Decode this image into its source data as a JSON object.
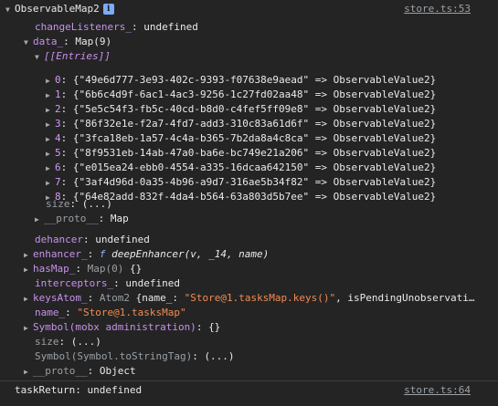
{
  "top_source": "store.ts:53",
  "bottom_source": "store.ts:64",
  "root": {
    "name": "ObservableMap2",
    "info_glyph": "i"
  },
  "change_listeners": {
    "key": "changeListeners_",
    "value": "undefined"
  },
  "data": {
    "key": "data_",
    "value": "Map(9)"
  },
  "entries_label": "[[Entries]]",
  "entries": [
    {
      "index": "0",
      "text": "{\"49e6d777-3e93-402c-9393-f07638e9aead\" => ObservableValue2}"
    },
    {
      "index": "1",
      "text": "{\"6b6c4d9f-6ac1-4ac3-9256-1c27fd02aa48\" => ObservableValue2}"
    },
    {
      "index": "2",
      "text": "{\"5e5c54f3-fb5c-40cd-b8d0-c4fef5ff09e8\" => ObservableValue2}"
    },
    {
      "index": "3",
      "text": "{\"86f32e1e-f2a7-4fd7-add3-310c83a61d6f\" => ObservableValue2}"
    },
    {
      "index": "4",
      "text": "{\"3fca18eb-1a57-4c4a-b365-7b2da8a4c8ca\" => ObservableValue2}"
    },
    {
      "index": "5",
      "text": "{\"8f9531eb-14ab-47a0-ba6e-bc749e21a206\" => ObservableValue2}"
    },
    {
      "index": "6",
      "text": "{\"e015ea24-ebb0-4554-a335-16dcaa642150\" => ObservableValue2}"
    },
    {
      "index": "7",
      "text": "{\"3af4d96d-0a35-4b96-a9d7-316ae5b34f82\" => ObservableValue2}"
    },
    {
      "index": "8",
      "text": "{\"64e82add-832f-4da4-b564-63a803d5b7ee\" => ObservableValue2}"
    }
  ],
  "size_inner": {
    "key": "size",
    "value": "(...)"
  },
  "proto_inner": {
    "key": "__proto__",
    "value": "Map"
  },
  "dehancer": {
    "key": "dehancer",
    "value": "undefined"
  },
  "enhancer": {
    "key": "enhancer_",
    "f": "f",
    "value": "deepEnhancer(v, _14, name)"
  },
  "has_map": {
    "key": "hasMap_",
    "type": "Map(0)",
    "value": "{}"
  },
  "interceptors": {
    "key": "interceptors_",
    "value": "undefined"
  },
  "keys_atom": {
    "key": "keysAtom_",
    "type": "Atom2",
    "name_key": "{name_:",
    "name_val": "\"Store@1.tasksMap.keys()\"",
    "rest": ", isPendingUnobservati…"
  },
  "name": {
    "key": "name_",
    "value": "\"Store@1.tasksMap\""
  },
  "symbol_admin": {
    "key": "Symbol(mobx administration)",
    "value": "{}"
  },
  "size_outer": {
    "key": "size",
    "value": "(...)"
  },
  "symbol_tag": {
    "key": "Symbol(Symbol.toStringTag)",
    "value": "(...)"
  },
  "proto_outer": {
    "key": "__proto__",
    "value": "Object"
  },
  "task_return": {
    "key": "taskReturn",
    "value": "undefined"
  },
  "colors": {
    "background": "#242424",
    "string": "#f28b54",
    "key": "#c792ea",
    "muted": "#9aa0a6"
  }
}
